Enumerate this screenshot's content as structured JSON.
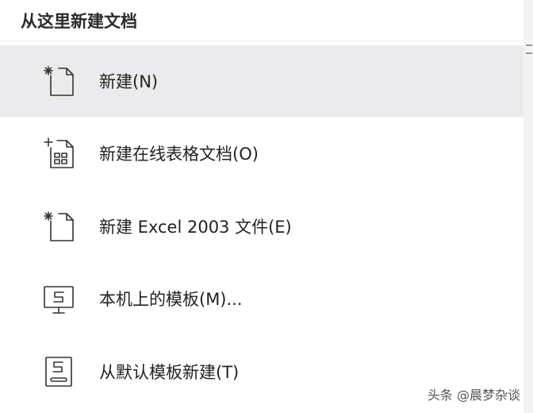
{
  "menu": {
    "header": "从这里新建文档",
    "items": [
      {
        "label": "新建(N)",
        "icon": "new-document-icon",
        "highlighted": true
      },
      {
        "label": "新建在线表格文档(O)",
        "icon": "new-online-sheet-icon",
        "highlighted": false
      },
      {
        "label": "新建 Excel 2003 文件(E)",
        "icon": "new-document-icon",
        "highlighted": false
      },
      {
        "label": "本机上的模板(M)...",
        "icon": "local-template-monitor-icon",
        "highlighted": false
      },
      {
        "label": "从默认模板新建(T)",
        "icon": "default-template-icon",
        "highlighted": false
      }
    ]
  },
  "watermark": "头条 @晨梦杂谈",
  "colors": {
    "highlight": "#ebebed",
    "text": "#222222",
    "icon_stroke": "#333333"
  }
}
